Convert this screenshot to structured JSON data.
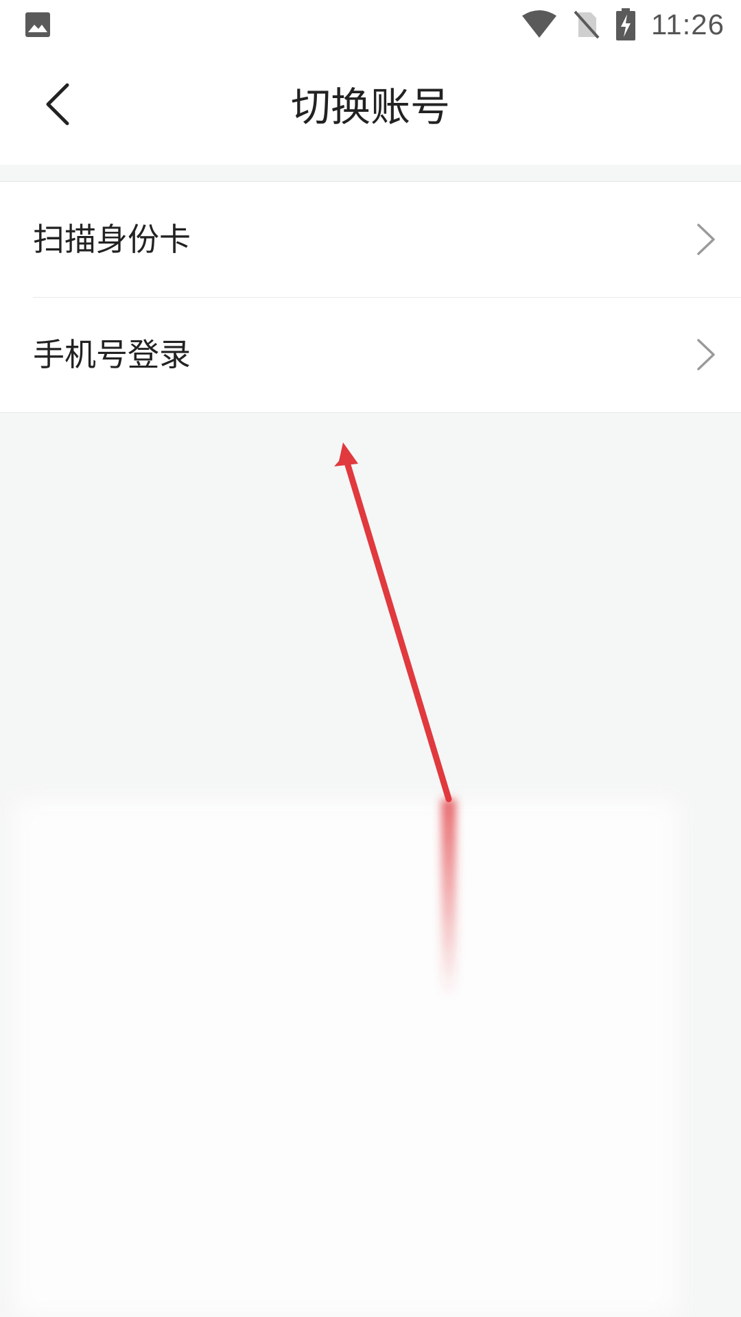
{
  "status_bar": {
    "time": "11:26",
    "icons": [
      "gallery-icon",
      "wifi-icon",
      "no-sim-icon",
      "battery-charging-icon"
    ]
  },
  "header": {
    "title": "切换账号",
    "back_icon": "chevron-left-icon"
  },
  "list": {
    "items": [
      {
        "label": "扫描身份卡",
        "icon": "chevron-right-icon"
      },
      {
        "label": "手机号登录",
        "icon": "chevron-right-icon"
      }
    ]
  },
  "colors": {
    "background": "#f5f6f6",
    "surface": "#ffffff",
    "annotation_arrow": "#e0393e",
    "chevron": "#9a9a9a"
  }
}
